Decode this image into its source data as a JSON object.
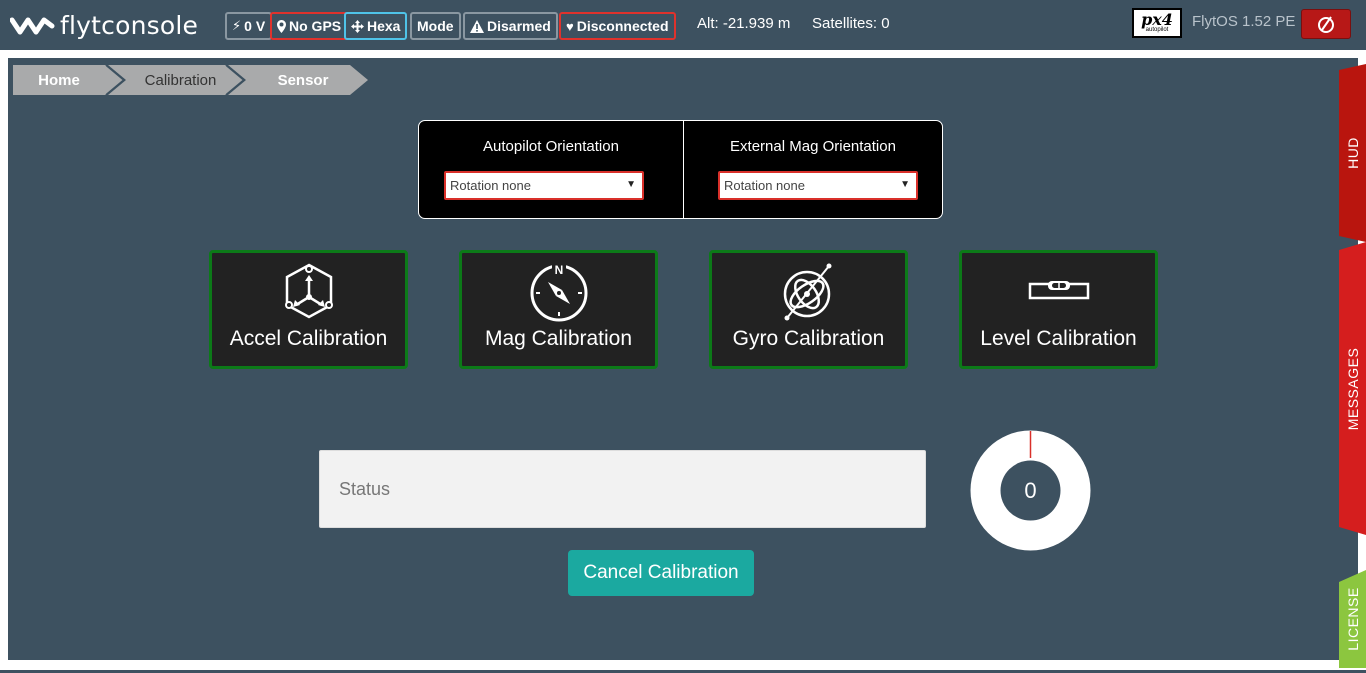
{
  "app": {
    "brand_light": "flyt",
    "brand_main": "console"
  },
  "header": {
    "battery": "0 V",
    "gps": "No GPS",
    "frame": "Hexa",
    "mode": "Mode",
    "arm_state": "Disarmed",
    "connection": "Disconnected",
    "altitude": "Alt: -21.939 m",
    "satellites": "Satellites: 0",
    "autopilot_logo_main": "px4",
    "autopilot_logo_sub": "autopilot",
    "os_version": "FlytOS 1.52 PE"
  },
  "breadcrumb": {
    "items": [
      "Home",
      "Calibration",
      "Sensor"
    ]
  },
  "orientation": {
    "autopilot_label": "Autopilot Orientation",
    "autopilot_value": "Rotation none",
    "external_mag_label": "External Mag Orientation",
    "external_mag_value": "Rotation none"
  },
  "calibrations": [
    {
      "label": "Accel Calibration",
      "icon": "accelerometer-icon"
    },
    {
      "label": "Mag Calibration",
      "icon": "compass-icon"
    },
    {
      "label": "Gyro Calibration",
      "icon": "gyroscope-icon"
    },
    {
      "label": "Level Calibration",
      "icon": "level-icon"
    }
  ],
  "status": {
    "placeholder": "Status",
    "progress_value": "0",
    "cancel_label": "Cancel Calibration"
  },
  "side_tabs": {
    "hud": "HUD",
    "messages": "MESSAGES",
    "license": "LICENSE"
  },
  "colors": {
    "panel_bg": "#3d5160",
    "card_border": "#0c7a18",
    "alert_red": "#e0322c",
    "frame_blue": "#4fc3e8",
    "cancel_teal": "#1ba9a0",
    "license_green": "#8cc63f"
  }
}
